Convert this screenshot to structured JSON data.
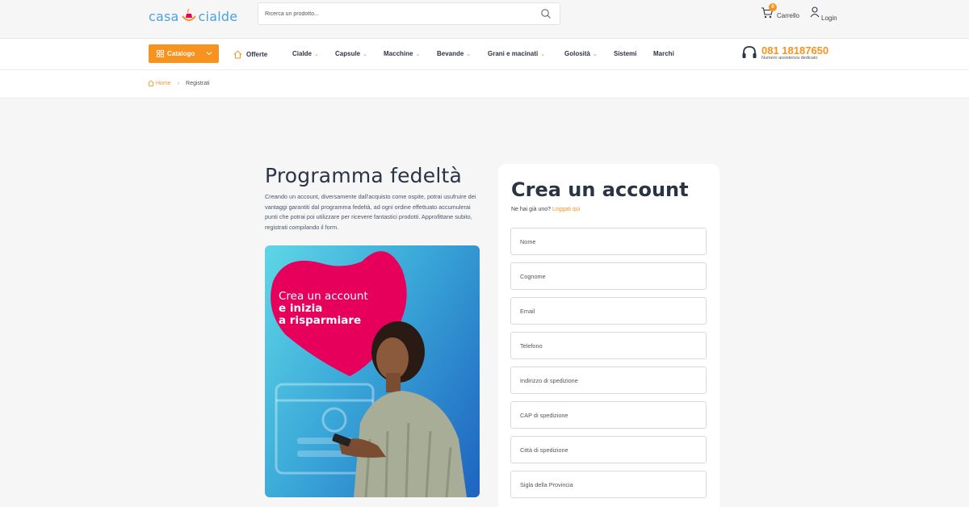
{
  "header": {
    "logo_left": "casa",
    "logo_right": "cialde",
    "search_placeholder": "Ricerca un prodotto...",
    "cart_count": "0",
    "cart_label": "Carrello",
    "login_label": "Login"
  },
  "nav": {
    "catalog_label": "Catalogo",
    "offers_label": "Offerte",
    "items": [
      {
        "label": "Cialde",
        "caret": "⌄"
      },
      {
        "label": "Capsule",
        "caret": "⌄"
      },
      {
        "label": "Macchine",
        "caret": "⌄"
      },
      {
        "label": "Bevande",
        "caret": "⌄"
      },
      {
        "label": "Grani e macinati",
        "caret": "⌄"
      },
      {
        "label": "Golosità",
        "caret": "⌄"
      },
      {
        "label": "Sistemi",
        "caret": ""
      },
      {
        "label": "Marchi",
        "caret": ""
      }
    ],
    "phone_number": "081 18187650",
    "phone_caption": "Numero assistenza dedicato"
  },
  "breadcrumb": {
    "home": "Home",
    "separator": "›",
    "current": "Registrati"
  },
  "promo": {
    "title": "Programma fedeltà",
    "text": "Creando un account, diversamente dall'acquisto come ospite, potrai usufruire dei vantaggi garantiti dal programma fedeltà, ad ogni ordine effettuato accumulerai punti che potrai poi utilizzare per ricevere fantastici prodotti. Approfittane subito, registrati compilando il form.",
    "headline_line1": "Crea un account",
    "headline_line2": "e inizia",
    "headline_line3": "a risparmiare"
  },
  "form": {
    "title": "Crea un account",
    "prompt": "Ne hai già uno?",
    "login_link": "Loggati qui",
    "fields": [
      {
        "placeholder": "Nome"
      },
      {
        "placeholder": "Cognome"
      },
      {
        "placeholder": "Email"
      },
      {
        "placeholder": "Telefono"
      },
      {
        "placeholder": "Indirizzo di spedizione"
      },
      {
        "placeholder": "CAP di spedizione"
      },
      {
        "placeholder": "Città di spedizione"
      },
      {
        "placeholder": "Sigla della Provincia"
      }
    ]
  },
  "colors": {
    "accent": "#f7931e",
    "logo_blue": "#4aa3df",
    "heart": "#e6005c",
    "text_dark": "#2b3445"
  }
}
